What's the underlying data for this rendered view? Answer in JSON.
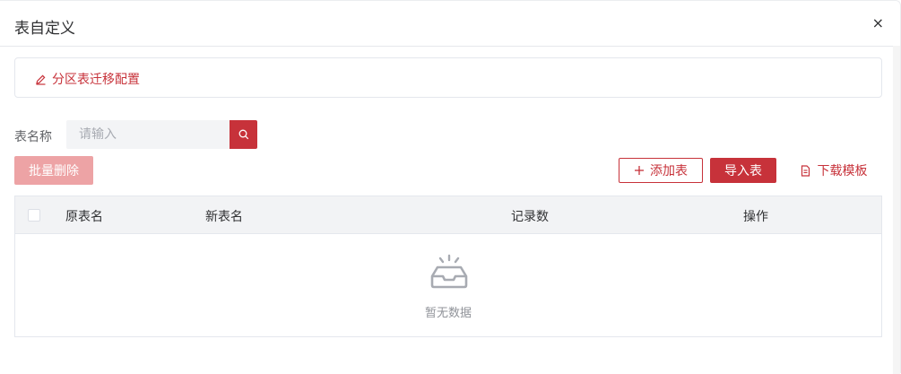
{
  "dialog": {
    "title": "表自定义",
    "close_symbol": "×"
  },
  "partition": {
    "link_label": "分区表迁移配置"
  },
  "search": {
    "label": "表名称",
    "placeholder": "请输入",
    "value": ""
  },
  "toolbar": {
    "batch_delete_label": "批量删除",
    "add_table_label": "添加表",
    "import_table_label": "导入表",
    "download_template_label": "下载模板"
  },
  "table": {
    "columns": [
      "原表名",
      "新表名",
      "记录数",
      "操作"
    ],
    "empty_text": "暂无数据"
  },
  "colors": {
    "accent": "#c7323a",
    "accent_disabled": "#eda3a5"
  },
  "icons": {
    "close": "close-icon",
    "edit": "edit-icon",
    "search": "search-icon",
    "plus": "plus-icon",
    "document": "document-icon",
    "empty": "empty-box-icon"
  }
}
